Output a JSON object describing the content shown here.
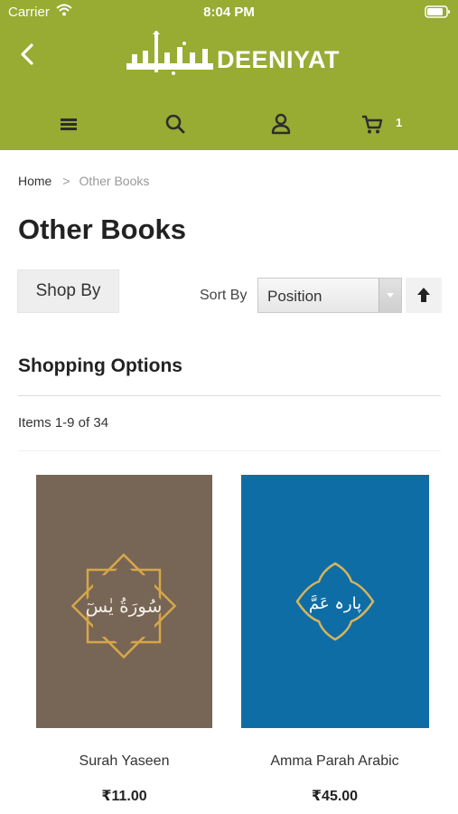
{
  "status_bar": {
    "carrier": "Carrier",
    "time": "8:04 PM"
  },
  "header": {
    "logo_text": "DEENIYAT",
    "logo_arabic": "دينيات",
    "cart_count": "1",
    "icons": [
      "back-icon",
      "menu-icon",
      "search-icon",
      "account-icon",
      "cart-icon"
    ],
    "color": "#98ab33"
  },
  "breadcrumb": {
    "home": "Home",
    "separator": ">",
    "current": "Other Books"
  },
  "page_title": "Other Books",
  "toolbar": {
    "shop_by": "Shop By",
    "sort_label": "Sort By",
    "sort_value": "Position",
    "sort_direction_icon": "arrow-up-icon"
  },
  "shopping_options": "Shopping Options",
  "items_count": "Items 1-9 of 34",
  "products": [
    {
      "name": "Surah Yaseen",
      "price": "₹11.00",
      "cover_color": "#776555",
      "cover_text": "سُورَةُ يٰسٓ"
    },
    {
      "name": "Amma Parah Arabic",
      "price": "₹45.00",
      "cover_color": "#0f6da5",
      "cover_text": "پارہ عَمَّ"
    }
  ]
}
